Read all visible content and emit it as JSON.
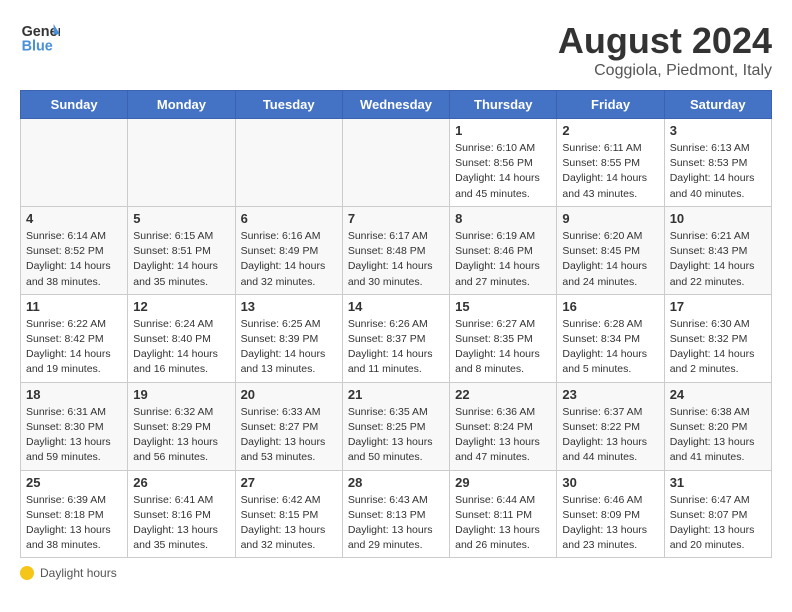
{
  "logo": {
    "line1": "General",
    "line2": "Blue"
  },
  "title": "August 2024",
  "subtitle": "Coggiola, Piedmont, Italy",
  "days_of_week": [
    "Sunday",
    "Monday",
    "Tuesday",
    "Wednesday",
    "Thursday",
    "Friday",
    "Saturday"
  ],
  "weeks": [
    [
      {
        "day": "",
        "info": ""
      },
      {
        "day": "",
        "info": ""
      },
      {
        "day": "",
        "info": ""
      },
      {
        "day": "",
        "info": ""
      },
      {
        "day": "1",
        "info": "Sunrise: 6:10 AM\nSunset: 8:56 PM\nDaylight: 14 hours and 45 minutes."
      },
      {
        "day": "2",
        "info": "Sunrise: 6:11 AM\nSunset: 8:55 PM\nDaylight: 14 hours and 43 minutes."
      },
      {
        "day": "3",
        "info": "Sunrise: 6:13 AM\nSunset: 8:53 PM\nDaylight: 14 hours and 40 minutes."
      }
    ],
    [
      {
        "day": "4",
        "info": "Sunrise: 6:14 AM\nSunset: 8:52 PM\nDaylight: 14 hours and 38 minutes."
      },
      {
        "day": "5",
        "info": "Sunrise: 6:15 AM\nSunset: 8:51 PM\nDaylight: 14 hours and 35 minutes."
      },
      {
        "day": "6",
        "info": "Sunrise: 6:16 AM\nSunset: 8:49 PM\nDaylight: 14 hours and 32 minutes."
      },
      {
        "day": "7",
        "info": "Sunrise: 6:17 AM\nSunset: 8:48 PM\nDaylight: 14 hours and 30 minutes."
      },
      {
        "day": "8",
        "info": "Sunrise: 6:19 AM\nSunset: 8:46 PM\nDaylight: 14 hours and 27 minutes."
      },
      {
        "day": "9",
        "info": "Sunrise: 6:20 AM\nSunset: 8:45 PM\nDaylight: 14 hours and 24 minutes."
      },
      {
        "day": "10",
        "info": "Sunrise: 6:21 AM\nSunset: 8:43 PM\nDaylight: 14 hours and 22 minutes."
      }
    ],
    [
      {
        "day": "11",
        "info": "Sunrise: 6:22 AM\nSunset: 8:42 PM\nDaylight: 14 hours and 19 minutes."
      },
      {
        "day": "12",
        "info": "Sunrise: 6:24 AM\nSunset: 8:40 PM\nDaylight: 14 hours and 16 minutes."
      },
      {
        "day": "13",
        "info": "Sunrise: 6:25 AM\nSunset: 8:39 PM\nDaylight: 14 hours and 13 minutes."
      },
      {
        "day": "14",
        "info": "Sunrise: 6:26 AM\nSunset: 8:37 PM\nDaylight: 14 hours and 11 minutes."
      },
      {
        "day": "15",
        "info": "Sunrise: 6:27 AM\nSunset: 8:35 PM\nDaylight: 14 hours and 8 minutes."
      },
      {
        "day": "16",
        "info": "Sunrise: 6:28 AM\nSunset: 8:34 PM\nDaylight: 14 hours and 5 minutes."
      },
      {
        "day": "17",
        "info": "Sunrise: 6:30 AM\nSunset: 8:32 PM\nDaylight: 14 hours and 2 minutes."
      }
    ],
    [
      {
        "day": "18",
        "info": "Sunrise: 6:31 AM\nSunset: 8:30 PM\nDaylight: 13 hours and 59 minutes."
      },
      {
        "day": "19",
        "info": "Sunrise: 6:32 AM\nSunset: 8:29 PM\nDaylight: 13 hours and 56 minutes."
      },
      {
        "day": "20",
        "info": "Sunrise: 6:33 AM\nSunset: 8:27 PM\nDaylight: 13 hours and 53 minutes."
      },
      {
        "day": "21",
        "info": "Sunrise: 6:35 AM\nSunset: 8:25 PM\nDaylight: 13 hours and 50 minutes."
      },
      {
        "day": "22",
        "info": "Sunrise: 6:36 AM\nSunset: 8:24 PM\nDaylight: 13 hours and 47 minutes."
      },
      {
        "day": "23",
        "info": "Sunrise: 6:37 AM\nSunset: 8:22 PM\nDaylight: 13 hours and 44 minutes."
      },
      {
        "day": "24",
        "info": "Sunrise: 6:38 AM\nSunset: 8:20 PM\nDaylight: 13 hours and 41 minutes."
      }
    ],
    [
      {
        "day": "25",
        "info": "Sunrise: 6:39 AM\nSunset: 8:18 PM\nDaylight: 13 hours and 38 minutes."
      },
      {
        "day": "26",
        "info": "Sunrise: 6:41 AM\nSunset: 8:16 PM\nDaylight: 13 hours and 35 minutes."
      },
      {
        "day": "27",
        "info": "Sunrise: 6:42 AM\nSunset: 8:15 PM\nDaylight: 13 hours and 32 minutes."
      },
      {
        "day": "28",
        "info": "Sunrise: 6:43 AM\nSunset: 8:13 PM\nDaylight: 13 hours and 29 minutes."
      },
      {
        "day": "29",
        "info": "Sunrise: 6:44 AM\nSunset: 8:11 PM\nDaylight: 13 hours and 26 minutes."
      },
      {
        "day": "30",
        "info": "Sunrise: 6:46 AM\nSunset: 8:09 PM\nDaylight: 13 hours and 23 minutes."
      },
      {
        "day": "31",
        "info": "Sunrise: 6:47 AM\nSunset: 8:07 PM\nDaylight: 13 hours and 20 minutes."
      }
    ]
  ],
  "footer": {
    "note": "Daylight hours"
  }
}
